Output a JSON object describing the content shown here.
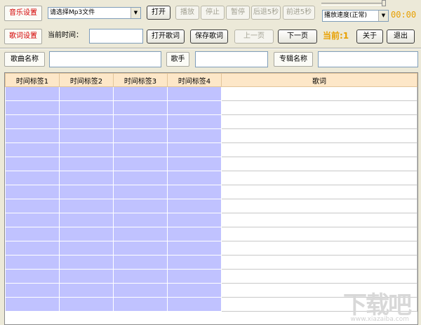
{
  "toolbar_row1": {
    "music_settings": "音乐设置",
    "file_select": "请选择Mp3文件",
    "open": "打开",
    "play": "播放",
    "stop": "停止",
    "pause": "暂停",
    "back5": "后退5秒",
    "forward5": "前进5秒",
    "speed_select": "播放速度(正常)",
    "time": "00:00"
  },
  "toolbar_row2": {
    "lyric_settings": "歌词设置",
    "current_time_label": "当前时间：",
    "current_time_value": "",
    "open_lyric": "打开歌词",
    "save_lyric": "保存歌词",
    "prev_page": "上一页",
    "next_page": "下一页",
    "current": "当前:1",
    "about": "关于",
    "exit": "退出"
  },
  "info_row": {
    "song_name_label": "歌曲名称",
    "song_name_value": "",
    "singer_label": "歌手",
    "singer_value": "",
    "album_label": "专辑名称",
    "album_value": ""
  },
  "table": {
    "headers": [
      "时间标签1",
      "时间标签2",
      "时间标签3",
      "时间标签4",
      "歌词"
    ],
    "row_count": 16
  },
  "watermark": {
    "main": "下载吧",
    "sub": "www.xiazaiba.com"
  },
  "colors": {
    "accent_red": "#d40000",
    "time_orange": "#e8a000",
    "timestamp_cell": "#c0c2ff",
    "header_bg": "#fde7c8"
  }
}
